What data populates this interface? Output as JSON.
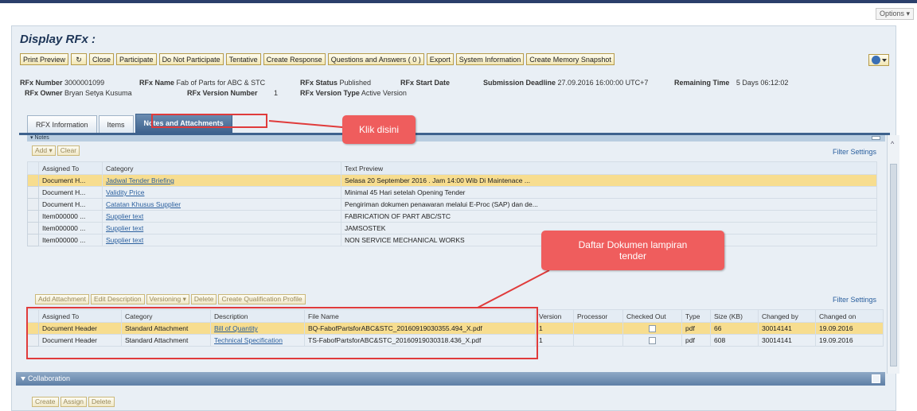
{
  "options_label": "Options",
  "page_title": "Display RFx :",
  "toolbar": {
    "buttons": [
      "Print Preview",
      "Close",
      "Participate",
      "Do Not Participate",
      "Tentative",
      "Create Response",
      "Questions and Answers ( 0 )",
      "Export",
      "System Information",
      "Create Memory Snapshot"
    ]
  },
  "header_info": {
    "rfx_number_label": "RFx Number",
    "rfx_number": "3000001099",
    "rfx_name_label": "RFx Name",
    "rfx_name": "Fab of Parts for ABC & STC",
    "rfx_status_label": "RFx Status",
    "rfx_status": "Published",
    "rfx_start_date_label": "RFx Start Date",
    "submission_deadline_label": "Submission Deadline",
    "submission_deadline": "27.09.2016 16:00:00 UTC+7",
    "remaining_time_label": "Remaining Time",
    "remaining_time": "5 Days 06:12:02",
    "rfx_owner_label": "RFx Owner",
    "rfx_owner": "Bryan Setya Kusuma",
    "rfx_version_number_label": "RFx Version Number",
    "rfx_version_number": "1",
    "rfx_version_type_label": "RFx Version Type",
    "rfx_version_type": "Active Version"
  },
  "tabs": [
    "RFX Information",
    "Items",
    "Notes and Attachments"
  ],
  "notes": {
    "section_label": "▾ Notes",
    "buttons": [
      "Add",
      "Clear"
    ],
    "filter_label": "Filter Settings",
    "columns": [
      "Assigned To",
      "Category",
      "Text Preview"
    ],
    "rows": [
      {
        "assigned": "Document H...",
        "category": "Jadwal Tender Briefing",
        "text": "Selasa 20 September 2016 . Jam 14:00 Wib Di Maintenace ..."
      },
      {
        "assigned": "Document H...",
        "category": "Validity Price",
        "text": "Minimal 45 Hari setelah Opening Tender"
      },
      {
        "assigned": "Document H...",
        "category": "Catatan Khusus Supplier",
        "text": "Pengiriman dokumen penawaran melalui E-Proc (SAP) dan de..."
      },
      {
        "assigned": "Item000000 ...",
        "category": "Supplier text",
        "text": "FABRICATION OF PART ABC/STC"
      },
      {
        "assigned": "Item000000 ...",
        "category": "Supplier text",
        "text": "JAMSOSTEK"
      },
      {
        "assigned": "Item000000 ...",
        "category": "Supplier text",
        "text": "NON SERVICE MECHANICAL WORKS"
      }
    ]
  },
  "attachments": {
    "buttons": [
      "Add Attachment",
      "Edit Description",
      "Versioning",
      "Delete",
      "Create Qualification Profile"
    ],
    "filter_label": "Filter Settings",
    "columns": [
      "Assigned To",
      "Category",
      "Description",
      "File Name",
      "Version",
      "Processor",
      "Checked Out",
      "Type",
      "Size (KB)",
      "Changed by",
      "Changed on"
    ],
    "rows": [
      {
        "assigned": "Document Header",
        "category": "Standard Attachment",
        "description": "Bill of Quantity",
        "file": "BQ-FabofPartsforABC&STC_20160919030355.494_X.pdf",
        "version": "1",
        "processor": "",
        "type": "pdf",
        "size": "66",
        "changed_by": "30014141",
        "changed_on": "19.09.2016"
      },
      {
        "assigned": "Document Header",
        "category": "Standard Attachment",
        "description": "Technical Specification",
        "file": "TS-FabofPartsforABC&STC_20160919030318.436_X.pdf",
        "version": "1",
        "processor": "",
        "type": "pdf",
        "size": "608",
        "changed_by": "30014141",
        "changed_on": "19.09.2016"
      }
    ]
  },
  "callouts": {
    "click_here": "Klik disini",
    "doc_list": "Daftar Dokumen lampiran tender"
  },
  "collaboration": {
    "title": "Collaboration",
    "buttons": [
      "Create",
      "Assign",
      "Delete"
    ]
  },
  "colors": {
    "callout": "#ef5d5d",
    "highlight_row": "#f7dd8f",
    "tab_active": "#3e628d"
  }
}
